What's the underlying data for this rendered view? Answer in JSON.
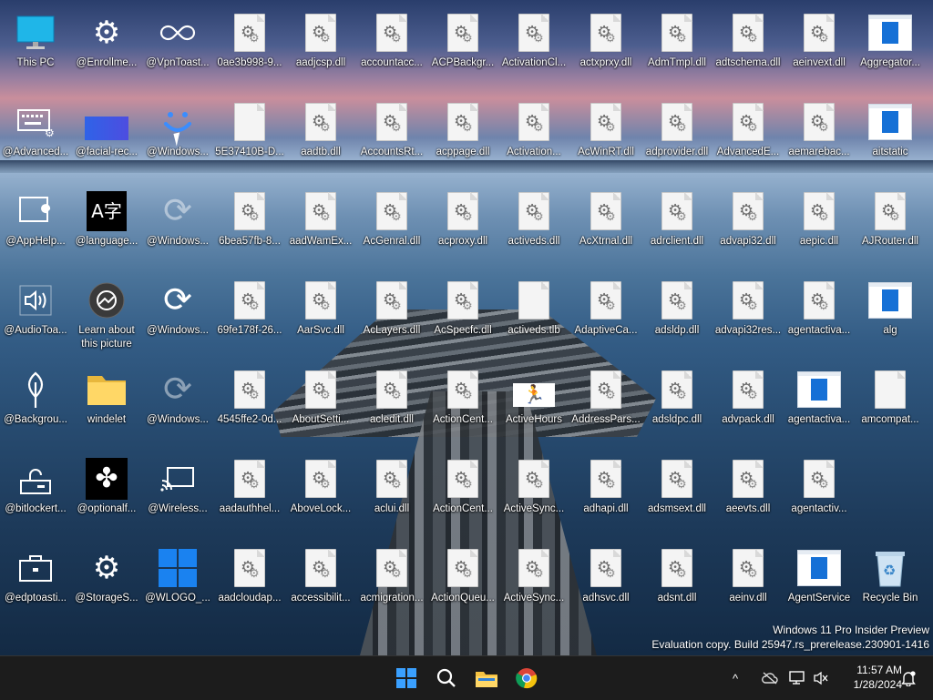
{
  "desktop": {
    "icons": [
      {
        "label": "This PC",
        "type": "monitor"
      },
      {
        "label": "@Enrollme...",
        "type": "gear"
      },
      {
        "label": "@VpnToast...",
        "type": "vpn"
      },
      {
        "label": "0ae3b998-9...",
        "type": "dll"
      },
      {
        "label": "aadjcsp.dll",
        "type": "dll"
      },
      {
        "label": "accountacc...",
        "type": "dll"
      },
      {
        "label": "ACPBackgr...",
        "type": "dll"
      },
      {
        "label": "ActivationCl...",
        "type": "dll"
      },
      {
        "label": "actxprxy.dll",
        "type": "dll"
      },
      {
        "label": "AdmTmpl.dll",
        "type": "dll"
      },
      {
        "label": "adtschema.dll",
        "type": "dll"
      },
      {
        "label": "aeinvext.dll",
        "type": "dll"
      },
      {
        "label": "Aggregator...",
        "type": "window"
      },
      {
        "label": "@Advanced...",
        "type": "keyboard"
      },
      {
        "label": "@facial-rec...",
        "type": "bluebar"
      },
      {
        "label": "@Windows...",
        "type": "smile"
      },
      {
        "label": "5E37410B-D...",
        "type": "blank"
      },
      {
        "label": "aadtb.dll",
        "type": "dll"
      },
      {
        "label": "AccountsRt...",
        "type": "dll"
      },
      {
        "label": "acppage.dll",
        "type": "dll"
      },
      {
        "label": "Activation...",
        "type": "dll"
      },
      {
        "label": "AcWinRT.dll",
        "type": "dll"
      },
      {
        "label": "adprovider.dll",
        "type": "dll"
      },
      {
        "label": "AdvancedE...",
        "type": "dll"
      },
      {
        "label": "aemarebac...",
        "type": "dll"
      },
      {
        "label": "aitstatic",
        "type": "window"
      },
      {
        "label": "@AppHelp...",
        "type": "wrench"
      },
      {
        "label": "@language...",
        "type": "lang"
      },
      {
        "label": "@Windows...",
        "type": "sync-faded"
      },
      {
        "label": "6bea57fb-8...",
        "type": "dll"
      },
      {
        "label": "aadWamEx...",
        "type": "dll"
      },
      {
        "label": "AcGenral.dll",
        "type": "dll"
      },
      {
        "label": "acproxy.dll",
        "type": "dll"
      },
      {
        "label": "activeds.dll",
        "type": "dll"
      },
      {
        "label": "AcXtrnal.dll",
        "type": "dll"
      },
      {
        "label": "adrclient.dll",
        "type": "dll"
      },
      {
        "label": "advapi32.dll",
        "type": "dll"
      },
      {
        "label": "aepic.dll",
        "type": "dll"
      },
      {
        "label": "AJRouter.dll",
        "type": "dll"
      },
      {
        "label": "@AudioToa...",
        "type": "speaker"
      },
      {
        "label": "Learn about this picture",
        "type": "learn"
      },
      {
        "label": "@Windows...",
        "type": "sync"
      },
      {
        "label": "69fe178f-26...",
        "type": "dll"
      },
      {
        "label": "AarSvc.dll",
        "type": "dll"
      },
      {
        "label": "AcLayers.dll",
        "type": "dll"
      },
      {
        "label": "AcSpecfc.dll",
        "type": "dll"
      },
      {
        "label": "activeds.tlb",
        "type": "blank"
      },
      {
        "label": "AdaptiveCa...",
        "type": "dll"
      },
      {
        "label": "adsldp.dll",
        "type": "dll"
      },
      {
        "label": "advapi32res...",
        "type": "dll"
      },
      {
        "label": "agentactiva...",
        "type": "dll"
      },
      {
        "label": "alg",
        "type": "window"
      },
      {
        "label": "@Backgrou...",
        "type": "leaf"
      },
      {
        "label": "windelet",
        "type": "folder"
      },
      {
        "label": "@Windows...",
        "type": "sync-faded"
      },
      {
        "label": "4545ffe2-0d...",
        "type": "dll"
      },
      {
        "label": "AboutSetti...",
        "type": "dll"
      },
      {
        "label": "acledit.dll",
        "type": "dll"
      },
      {
        "label": "ActionCent...",
        "type": "dll"
      },
      {
        "label": "ActiveHours",
        "type": "person"
      },
      {
        "label": "AddressPars...",
        "type": "dll"
      },
      {
        "label": "adsldpc.dll",
        "type": "dll"
      },
      {
        "label": "advpack.dll",
        "type": "dll"
      },
      {
        "label": "agentactiva...",
        "type": "window"
      },
      {
        "label": "amcompat...",
        "type": "blank"
      },
      {
        "label": "@bitlockert...",
        "type": "lock"
      },
      {
        "label": "@optionalf...",
        "type": "puzzle"
      },
      {
        "label": "@Wireless...",
        "type": "cast"
      },
      {
        "label": "aadauthhel...",
        "type": "dll"
      },
      {
        "label": "AboveLock...",
        "type": "dll"
      },
      {
        "label": "aclui.dll",
        "type": "dll"
      },
      {
        "label": "ActionCent...",
        "type": "dll"
      },
      {
        "label": "ActiveSync...",
        "type": "dll"
      },
      {
        "label": "adhapi.dll",
        "type": "dll"
      },
      {
        "label": "adsmsext.dll",
        "type": "dll"
      },
      {
        "label": "aeevts.dll",
        "type": "dll"
      },
      {
        "label": "agentactiv...",
        "type": "dll"
      },
      {
        "label": "",
        "type": "none"
      },
      {
        "label": "@edptoasti...",
        "type": "briefcase"
      },
      {
        "label": "@StorageS...",
        "type": "gear"
      },
      {
        "label": "@WLOGO_...",
        "type": "winlogo"
      },
      {
        "label": "aadcloudap...",
        "type": "dll"
      },
      {
        "label": "accessibilit...",
        "type": "dll"
      },
      {
        "label": "acmigration...",
        "type": "dll"
      },
      {
        "label": "ActionQueu...",
        "type": "dll"
      },
      {
        "label": "ActiveSync...",
        "type": "dll"
      },
      {
        "label": "adhsvc.dll",
        "type": "dll"
      },
      {
        "label": "adsnt.dll",
        "type": "dll"
      },
      {
        "label": "aeinv.dll",
        "type": "dll"
      },
      {
        "label": "AgentService",
        "type": "window"
      },
      {
        "label": "Recycle Bin",
        "type": "recycle"
      }
    ]
  },
  "watermark": {
    "line1": "Windows 11 Pro Insider Preview",
    "line2": "Evaluation copy. Build 25947.rs_prerelease.230901-1416"
  },
  "taskbar": {
    "items": [
      {
        "name": "start-button",
        "icon": "windows-logo-icon"
      },
      {
        "name": "search-button",
        "icon": "search-icon"
      },
      {
        "name": "file-explorer-button",
        "icon": "folder-icon"
      },
      {
        "name": "chrome-button",
        "icon": "chrome-icon"
      }
    ],
    "tray": {
      "chevron": "^",
      "time": "11:57 AM",
      "date": "1/28/2024"
    }
  }
}
